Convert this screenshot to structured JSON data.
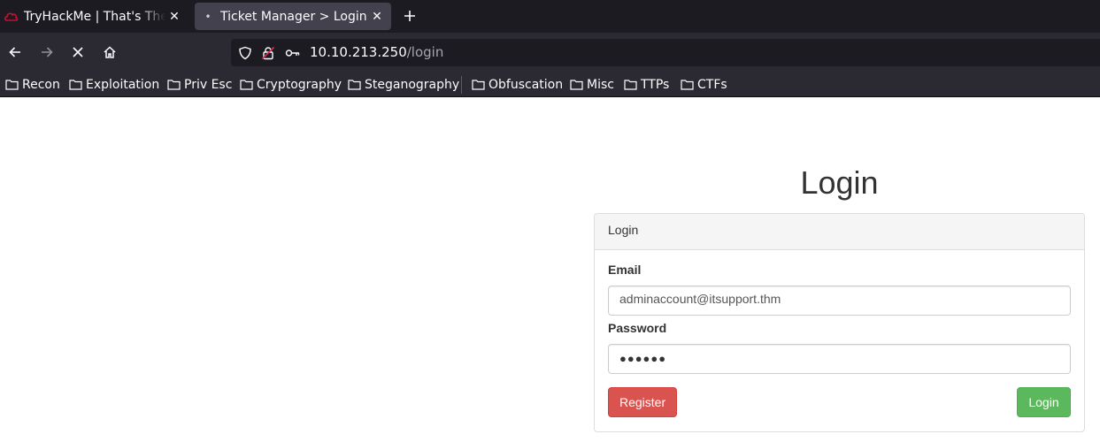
{
  "browser": {
    "tabs": [
      {
        "title": "TryHackMe | That's The Ticket",
        "active": false,
        "icon": "tryhackme-favicon-icon"
      },
      {
        "title": "Ticket Manager > Login",
        "active": true,
        "icon": "loading-dot-icon"
      }
    ],
    "url": {
      "host": "10.10.213.250",
      "path": "/login"
    },
    "bookmarks": [
      "Recon",
      "Exploitation",
      "Priv Esc",
      "Cryptography",
      "Steganography",
      "Obfuscation",
      "Misc",
      "TTPs",
      "CTFs"
    ]
  },
  "page": {
    "title": "Login",
    "panel_heading": "Login",
    "email_label": "Email",
    "email_value": "adminaccount@itsupport.thm",
    "password_label": "Password",
    "password_mask": "●●●●●●",
    "register_label": "Register",
    "login_label": "Login"
  },
  "colors": {
    "register_button": "#d9534f",
    "login_button": "#5cb85c",
    "chrome_dark": "#1c1b22",
    "chrome_toolbar": "#2b2a33"
  }
}
